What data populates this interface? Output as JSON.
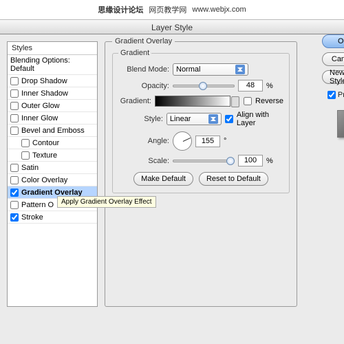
{
  "topbar": {
    "site1": "思缘设计论坛",
    "site2": "网页教学网",
    "url": "www.webjx.com"
  },
  "dialog": {
    "title": "Layer Style"
  },
  "sidebar": {
    "header": "Styles",
    "blending": "Blending Options: Default",
    "items": [
      {
        "label": "Drop Shadow",
        "checked": false
      },
      {
        "label": "Inner Shadow",
        "checked": false
      },
      {
        "label": "Outer Glow",
        "checked": false
      },
      {
        "label": "Inner Glow",
        "checked": false
      },
      {
        "label": "Bevel and Emboss",
        "checked": false
      },
      {
        "label": "Contour",
        "checked": false,
        "sub": true
      },
      {
        "label": "Texture",
        "checked": false,
        "sub": true
      },
      {
        "label": "Satin",
        "checked": false
      },
      {
        "label": "Color Overlay",
        "checked": false
      },
      {
        "label": "Gradient Overlay",
        "checked": true,
        "selected": true
      },
      {
        "label": "Pattern O",
        "checked": false
      },
      {
        "label": "Stroke",
        "checked": true
      }
    ]
  },
  "overlay": {
    "groupTitle": "Gradient Overlay",
    "subTitle": "Gradient",
    "blendModeLabel": "Blend Mode:",
    "blendModeValue": "Normal",
    "opacityLabel": "Opacity:",
    "opacityValue": "48",
    "percent": "%",
    "gradientLabel": "Gradient:",
    "reverseLabel": "Reverse",
    "styleLabel": "Style:",
    "styleValue": "Linear",
    "alignLabel": "Align with Layer",
    "angleLabel": "Angle:",
    "angleValue": "155",
    "degree": "°",
    "scaleLabel": "Scale:",
    "scaleValue": "100",
    "makeDefault": "Make Default",
    "resetDefault": "Reset to Default"
  },
  "buttons": {
    "ok": "OK",
    "cancel": "Cancel",
    "newStyle": "New Style",
    "preview": "Preview"
  },
  "tooltip": "Apply Gradient Overlay Effect"
}
